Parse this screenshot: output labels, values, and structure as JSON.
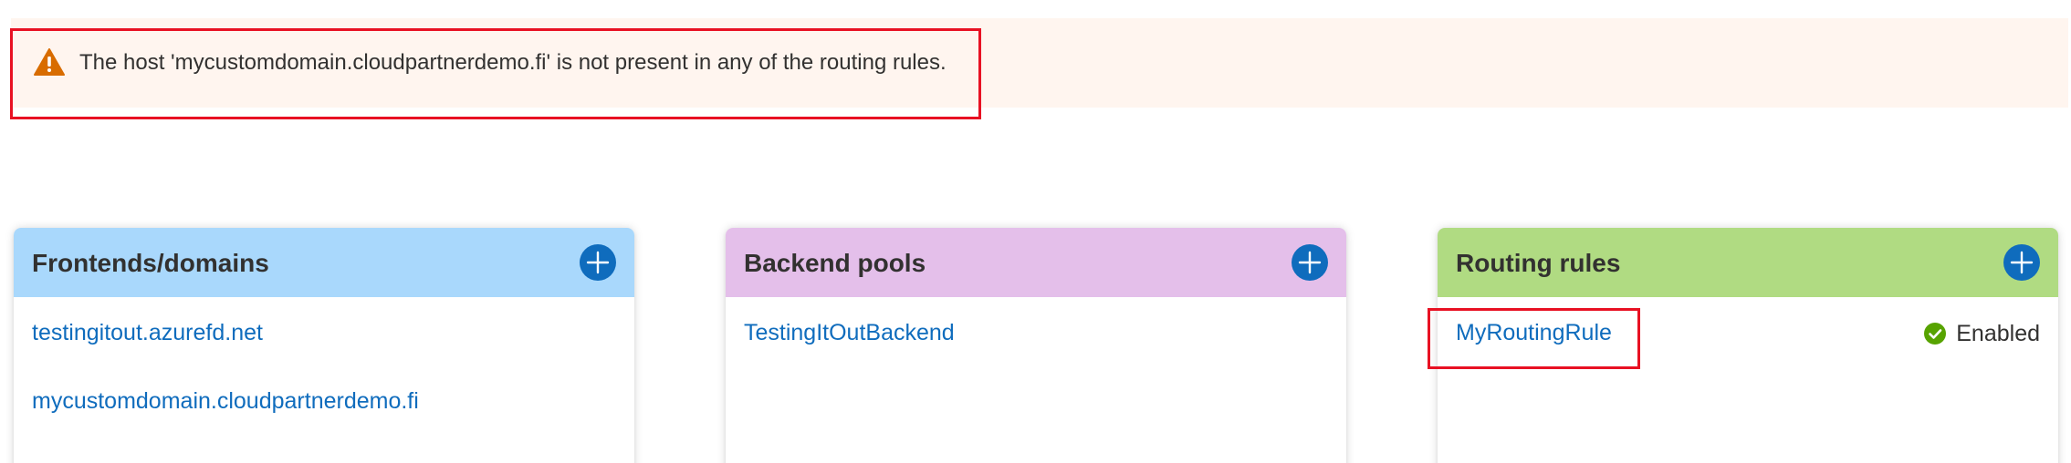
{
  "warning": {
    "icon": "warning-triangle-icon",
    "message": "The host 'mycustomdomain.cloudpartnerdemo.fi' is not present in any of the routing rules."
  },
  "cards": {
    "frontends": {
      "title": "Frontends/domains",
      "header_color": "#a9d8fc",
      "items": [
        "testingitout.azurefd.net",
        "mycustomdomain.cloudpartnerdemo.fi"
      ]
    },
    "backends": {
      "title": "Backend pools",
      "header_color": "#e4bfea",
      "items": [
        "TestingItOutBackend"
      ]
    },
    "routing": {
      "title": "Routing rules",
      "header_color": "#b0db82",
      "items": [
        {
          "name": "MyRoutingRule",
          "status": "Enabled",
          "status_icon": "check-circle-icon"
        }
      ]
    }
  },
  "colors": {
    "accent": "#0f6cbd",
    "warning_bg": "#fff5ef",
    "highlight_border": "#e81123",
    "success": "#57a300",
    "warning_icon": "#d86c00"
  }
}
